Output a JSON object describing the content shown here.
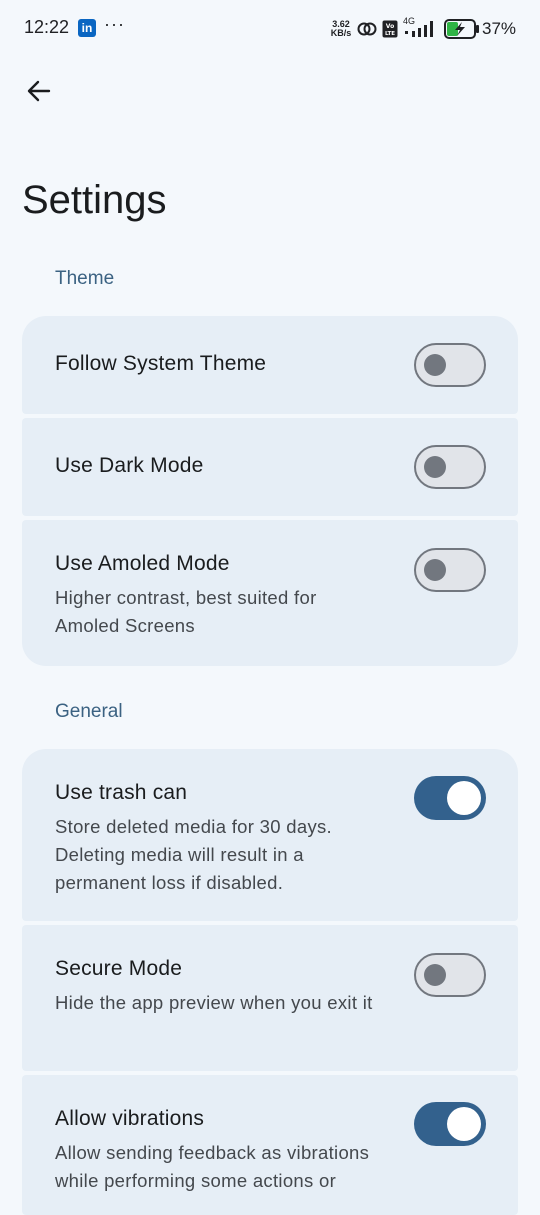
{
  "status_bar": {
    "time": "12:22",
    "app_icon": "linkedin-icon",
    "app_icon_text": "in",
    "more": "···",
    "net_speed_value": "3.62",
    "net_speed_unit": "KB/s",
    "network": "4G",
    "battery_percent": "37%"
  },
  "app_bar": {
    "back_icon": "arrow-back-icon",
    "title": "Settings"
  },
  "sections": {
    "theme": {
      "header": "Theme",
      "follow_system": {
        "title": "Follow System Theme",
        "checked": false
      },
      "dark_mode": {
        "title": "Use Dark Mode",
        "checked": false
      },
      "amoled": {
        "title": "Use Amoled Mode",
        "description": "Higher contrast, best suited for Amoled Screens",
        "checked": false
      }
    },
    "general": {
      "header": "General",
      "trash_can": {
        "title": "Use trash can",
        "description": "Store deleted media for 30 days. Deleting media will result in a permanent loss if disabled.",
        "checked": true
      },
      "secure_mode": {
        "title": "Secure Mode",
        "description": "Hide the app preview when you exit it",
        "checked": false
      },
      "vibrations": {
        "title": "Allow vibrations",
        "description": "Allow sending feedback as vibrations while performing some actions or",
        "checked": true
      }
    }
  },
  "colors": {
    "background": "#f4f8fc",
    "card": "#e6eef6",
    "accent": "#33618d",
    "section_header": "#3b6282",
    "toggle_off_outline": "#72777f"
  }
}
